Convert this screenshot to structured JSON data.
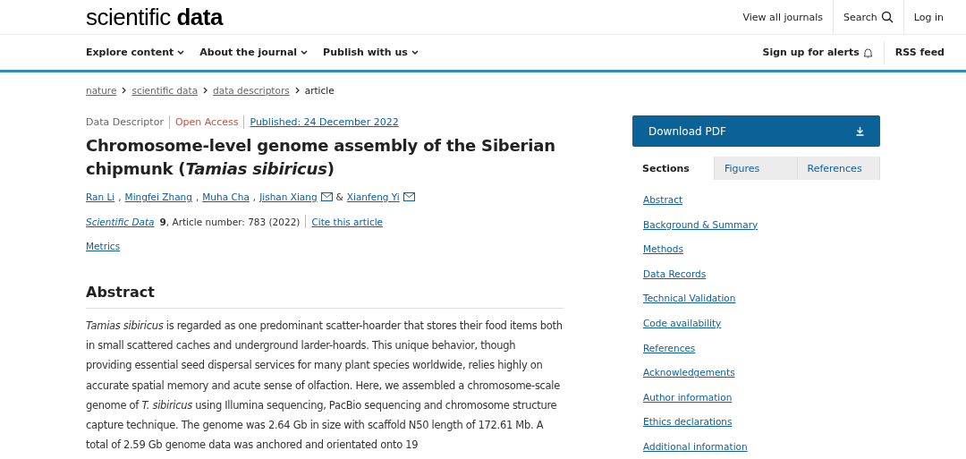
{
  "header": {
    "logo_light": "scientific",
    "logo_bold": "data",
    "links": [
      {
        "label": "View all journals",
        "kind": "text"
      },
      {
        "label": "Search",
        "kind": "search"
      },
      {
        "label": "Log in",
        "kind": "text"
      }
    ]
  },
  "nav": {
    "menus": [
      "Explore content",
      "About the journal",
      "Publish with us"
    ],
    "alerts": "Sign up for alerts",
    "rss": "RSS feed"
  },
  "breadcrumbs": [
    {
      "label": "nature",
      "kind": "link"
    },
    {
      "label": "scientific data",
      "kind": "link"
    },
    {
      "label": "data descriptors",
      "kind": "link"
    },
    {
      "label": "article",
      "kind": "current"
    }
  ],
  "article": {
    "type": "Data Descriptor",
    "access": "Open Access",
    "published": "Published: 24 December 2022",
    "title": "Chromosome-level genome assembly of the Siberian chipmunk (*Tamias sibiricus*)",
    "authors": [
      {
        "name": "Ran Li",
        "contact": false,
        "separator": ","
      },
      {
        "name": "Mingfei Zhang",
        "contact": false,
        "separator": ","
      },
      {
        "name": "Muha Cha",
        "contact": false,
        "separator": ","
      },
      {
        "name": "Jishan Xiang",
        "contact": true,
        "separator": "&"
      },
      {
        "name": "Xianfeng Yi",
        "contact": true
      }
    ],
    "journal": "Scientific Data",
    "citation": "**9**, Article number: 783 (2022)",
    "cite": "Cite this article",
    "metrics": "Metrics",
    "abstract_heading": "Abstract",
    "abstract": "*Tamias sibiricus* is regarded as one predominant scatter-hoarder that stores their food items both in small scattered caches and underground larder-hoards. This unique behavior, though providing essential seed dispersal services for many plant species worldwide, relies highly on accurate spatial memory and acute sense of olfaction. Here, we assembled a chromosome-scale genome of *T. sibiricus* using Illumina sequencing, PacBio sequencing and chromosome structure capture technique. The genome was 2.64 Gb in size with scaffold N50 length of 172.61 Mb. A total of 2.59 Gb genome data was anchored and orientated onto 19"
  },
  "sidebar": {
    "download": "Download PDF",
    "tabs": [
      {
        "label": "Sections",
        "selected": true
      },
      {
        "label": "Figures",
        "selected": false
      },
      {
        "label": "References",
        "selected": false
      }
    ],
    "sections": [
      "Abstract",
      "Background & Summary",
      "Methods",
      "Data Records",
      "Technical Validation",
      "Code availability",
      "References",
      "Acknowledgements",
      "Author information",
      "Ethics declarations",
      "Additional information"
    ]
  }
}
